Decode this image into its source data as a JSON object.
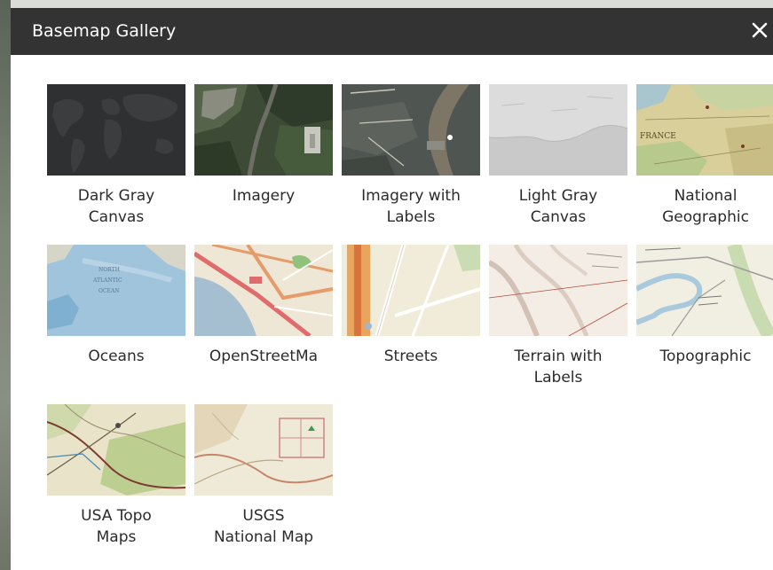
{
  "dialog": {
    "title": "Basemap Gallery",
    "close_label": "×"
  },
  "basemaps": [
    {
      "label": "Dark Gray\nCanvas",
      "icon": "dark-gray-canvas-thumbnail"
    },
    {
      "label": "Imagery",
      "icon": "imagery-thumbnail"
    },
    {
      "label": "Imagery with\nLabels",
      "icon": "imagery-with-labels-thumbnail"
    },
    {
      "label": "Light Gray\nCanvas",
      "icon": "light-gray-canvas-thumbnail"
    },
    {
      "label": "National\nGeographic",
      "icon": "national-geographic-thumbnail",
      "thumb_text": "FRANCE"
    },
    {
      "label": "Oceans",
      "icon": "oceans-thumbnail",
      "thumb_text": [
        "NORTH",
        "ATLANTIC",
        "OCEAN"
      ]
    },
    {
      "label": "OpenStreetMa",
      "icon": "openstreetmap-thumbnail"
    },
    {
      "label": "Streets",
      "icon": "streets-thumbnail"
    },
    {
      "label": "Terrain with\nLabels",
      "icon": "terrain-with-labels-thumbnail"
    },
    {
      "label": "Topographic",
      "icon": "topographic-thumbnail"
    },
    {
      "label": "USA Topo\nMaps",
      "icon": "usa-topo-maps-thumbnail"
    },
    {
      "label": "USGS\nNational Map",
      "icon": "usgs-national-map-thumbnail"
    }
  ],
  "colors": {
    "titlebar": "#333333",
    "title_text": "#ffffff",
    "label_text": "#2b2b2b"
  }
}
